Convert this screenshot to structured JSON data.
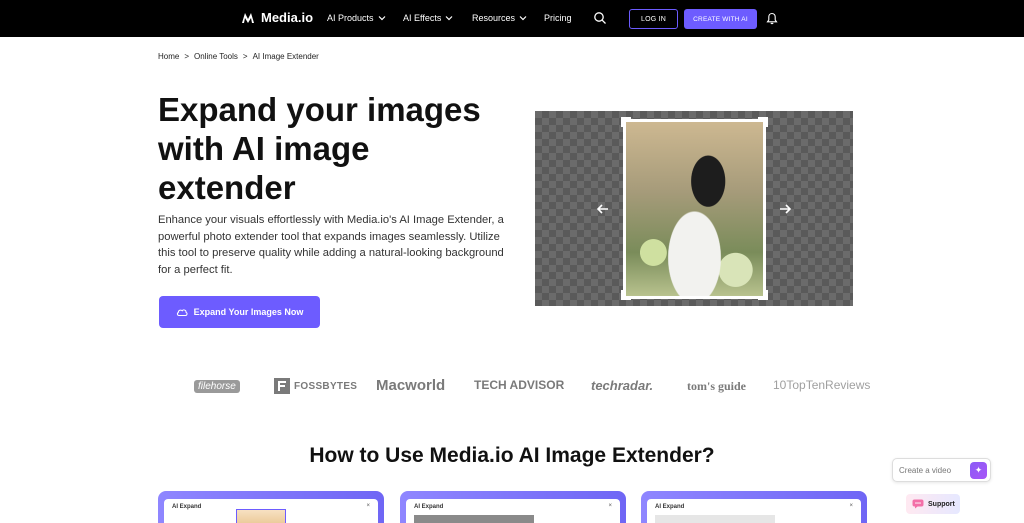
{
  "nav": {
    "brand": "Media.io",
    "items": [
      {
        "label": "AI Products"
      },
      {
        "label": "AI Effects"
      },
      {
        "label": "Resources"
      },
      {
        "label": "Pricing"
      }
    ],
    "login": "LOG IN",
    "create": "CREATE WITH AI"
  },
  "breadcrumb": [
    "Home",
    ">",
    "Online Tools",
    ">",
    "AI Image Extender"
  ],
  "hero": {
    "title": "Expand your images with AI image extender",
    "description": "Enhance your visuals effortlessly with Media.io's AI Image Extender, a powerful photo extender tool that expands images seamlessly. Utilize this tool to preserve quality while adding a natural-looking background for a perfect fit.",
    "cta": "Expand Your Images Now"
  },
  "logos": [
    "filehorse",
    "FOSSBYTES",
    "Macworld",
    "TECH ADVISOR",
    "techradar.",
    "tom's guide",
    "10TopTenReviews"
  ],
  "how_to": {
    "title": "How to Use Media.io AI Image Extender?",
    "cards": [
      {
        "label": "AI Expand"
      },
      {
        "label": "AI Expand"
      },
      {
        "label": "AI Expand"
      }
    ]
  },
  "widgets": {
    "create_video_placeholder": "Create a video",
    "support": "Support"
  },
  "colors": {
    "accent": "#6d5cff",
    "nav_bg": "#000000"
  }
}
